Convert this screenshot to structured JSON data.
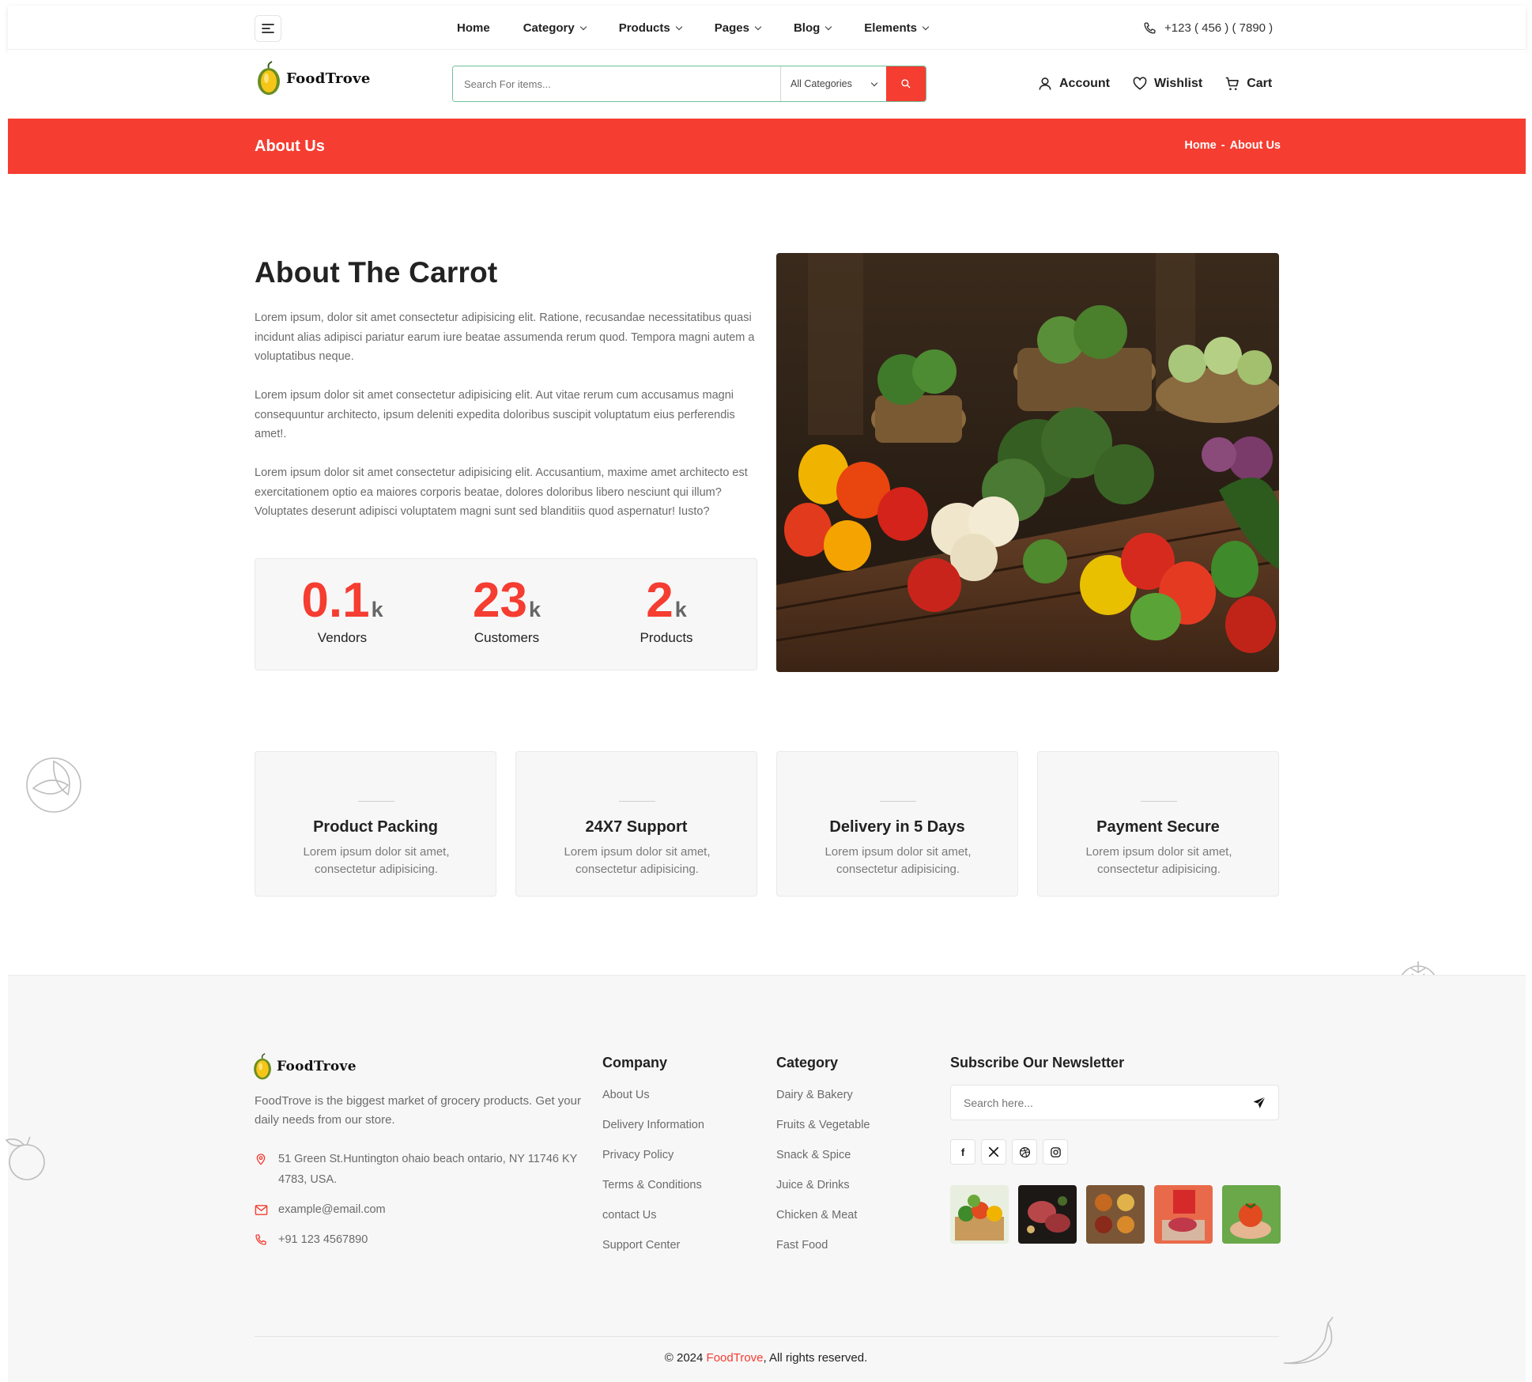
{
  "topnav": {
    "items": [
      {
        "label": "Home",
        "has_dropdown": false
      },
      {
        "label": "Category",
        "has_dropdown": true
      },
      {
        "label": "Products",
        "has_dropdown": true
      },
      {
        "label": "Pages",
        "has_dropdown": true
      },
      {
        "label": "Blog",
        "has_dropdown": true
      },
      {
        "label": "Elements",
        "has_dropdown": true
      }
    ],
    "phone": "+123 ( 456 ) ( 7890 )"
  },
  "header": {
    "logo_text": "FoodTrove",
    "search_placeholder": "Search For items...",
    "category_select": "All Categories",
    "account": "Account",
    "wishlist": "Wishlist",
    "cart": "Cart"
  },
  "banner": {
    "title": "About Us",
    "breadcrumb": [
      "Home",
      "-",
      "About Us"
    ]
  },
  "about": {
    "title": "About The Carrot",
    "paragraphs": [
      "Lorem ipsum, dolor sit amet consectetur adipisicing elit. Ratione, recusandae necessitatibus quasi incidunt alias adipisci pariatur earum iure beatae assumenda rerum quod. Tempora magni autem a voluptatibus neque.",
      "Lorem ipsum dolor sit amet consectetur adipisicing elit. Aut vitae rerum cum accusamus magni consequuntur architecto, ipsum deleniti expedita doloribus suscipit voluptatum eius perferendis amet!.",
      "Lorem ipsum dolor sit amet consectetur adipisicing elit. Accusantium, maxime amet architecto est exercitationem optio ea maiores corporis beatae, dolores doloribus libero nesciunt qui illum? Voluptates deserunt adipisci voluptatem magni sunt sed blanditiis quod aspernatur! Iusto?"
    ],
    "stats": [
      {
        "value": "0.1",
        "unit": "k",
        "label": "Vendors"
      },
      {
        "value": "23",
        "unit": "k",
        "label": "Customers"
      },
      {
        "value": "2",
        "unit": "k",
        "label": "Products"
      }
    ]
  },
  "services": [
    {
      "title": "Product Packing",
      "desc": "Lorem ipsum dolor sit amet, consectetur adipisicing."
    },
    {
      "title": "24X7 Support",
      "desc": "Lorem ipsum dolor sit amet, consectetur adipisicing."
    },
    {
      "title": "Delivery in 5 Days",
      "desc": "Lorem ipsum dolor sit amet, consectetur adipisicing."
    },
    {
      "title": "Payment Secure",
      "desc": "Lorem ipsum dolor sit amet, consectetur adipisicing."
    }
  ],
  "footer": {
    "logo_text": "FoodTrove",
    "description": "FoodTrove is the biggest market of grocery products. Get your daily needs from our store.",
    "address": "51 Green St.Huntington ohaio beach ontario, NY 11746 KY 4783, USA.",
    "email": "example@email.com",
    "phone": "+91 123 4567890",
    "company_title": "Company",
    "company_links": [
      "About Us",
      "Delivery Information",
      "Privacy Policy",
      "Terms & Conditions",
      "contact Us",
      "Support Center"
    ],
    "category_title": "Category",
    "category_links": [
      "Dairy & Bakery",
      "Fruits & Vegetable",
      "Snack & Spice",
      "Juice & Drinks",
      "Chicken & Meat",
      "Fast Food"
    ],
    "newsletter_title": "Subscribe Our Newsletter",
    "newsletter_placeholder": "Search here...",
    "social": [
      "facebook-icon",
      "x-icon",
      "dribbble-icon",
      "instagram-icon"
    ],
    "copyright_prefix": "© 2024 ",
    "copyright_brand": "FoodTrove",
    "copyright_suffix": ", All rights reserved."
  },
  "colors": {
    "accent": "#f53d31",
    "search_border": "#6fbf9c",
    "panel_bg": "#f7f7f7"
  }
}
